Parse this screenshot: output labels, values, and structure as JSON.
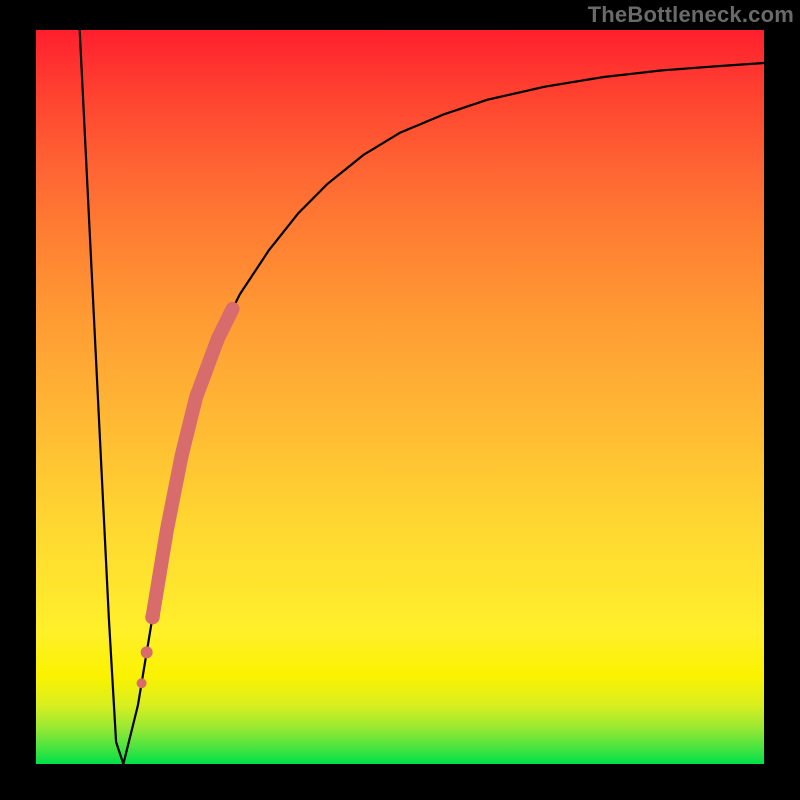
{
  "watermark": {
    "text": "TheBottleneck.com"
  },
  "colors": {
    "background": "#000000",
    "curve": "#000000",
    "highlight": "#d86b6b",
    "gradient_top": "#ff1f2e",
    "gradient_bottom": "#00e04a"
  },
  "chart_data": {
    "type": "line",
    "title": "",
    "xlabel": "",
    "ylabel": "",
    "xlim": [
      0,
      100
    ],
    "ylim": [
      0,
      100
    ],
    "x": [
      6,
      8,
      10,
      11,
      12,
      14,
      16,
      18,
      20,
      22,
      25,
      28,
      32,
      36,
      40,
      45,
      50,
      56,
      62,
      70,
      78,
      86,
      94,
      100
    ],
    "y": [
      100,
      60,
      20,
      3,
      0,
      8,
      20,
      32,
      42,
      50,
      58,
      64,
      70,
      75,
      79,
      83,
      86,
      88.5,
      90.5,
      92.3,
      93.6,
      94.5,
      95.1,
      95.5
    ],
    "minimum_x": 12,
    "highlight_segment": {
      "x_start": 16,
      "x_end": 27
    },
    "dots_x": [
      14.5,
      15.2,
      16.0
    ],
    "grid": false,
    "legend": false
  }
}
